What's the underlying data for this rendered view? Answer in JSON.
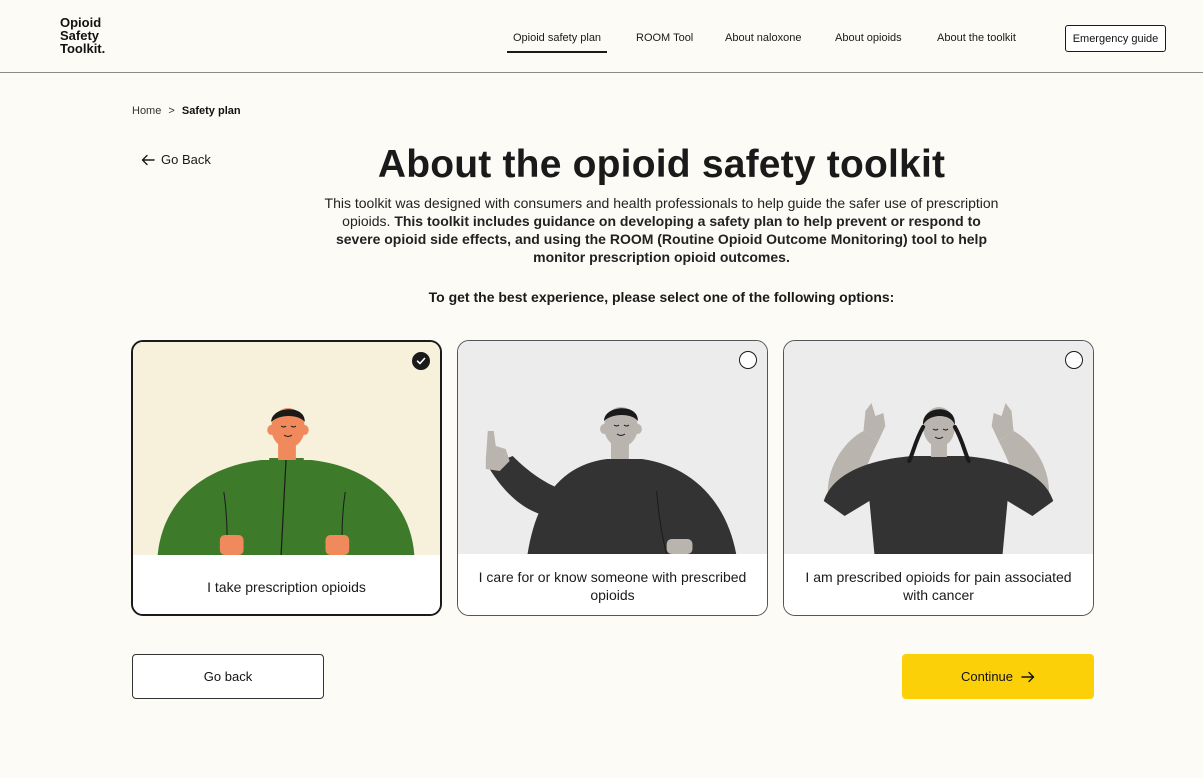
{
  "header": {
    "logo_lines": [
      "Opioid",
      "Safety",
      "Toolkit."
    ],
    "nav": [
      {
        "label": "Opioid safety plan",
        "active": true
      },
      {
        "label": "ROOM Tool",
        "active": false
      },
      {
        "label": "About naloxone",
        "active": false
      },
      {
        "label": "About opioids",
        "active": false
      },
      {
        "label": "About the toolkit",
        "active": false
      }
    ],
    "emergency_label": "Emergency guide"
  },
  "breadcrumb": {
    "home": "Home",
    "separator": ">",
    "current": "Safety plan"
  },
  "go_back_link": "Go Back",
  "title": "About the opioid safety toolkit",
  "intro": {
    "plain": "This toolkit was designed with consumers and health professionals to help guide the safer use of prescription opioids. ",
    "bold": "This toolkit includes guidance on developing a safety plan to help prevent or respond to severe opioid side effects, and using the ROOM (Routine Opioid Outcome Monitoring) tool to help monitor prescription opioid outcomes."
  },
  "prompt": "To get the best experience, please select one of the following options:",
  "options": [
    {
      "label": "I take prescription opioids",
      "selected": true
    },
    {
      "label": "I care for or know someone with prescribed opioids",
      "selected": false
    },
    {
      "label": "I am prescribed opioids for pain associated with cancer",
      "selected": false
    }
  ],
  "buttons": {
    "back": "Go back",
    "continue": "Continue"
  },
  "colors": {
    "background": "#fcfbf6",
    "accent_yellow": "#fcd008",
    "selected_card_bg": "#f7f1dc",
    "card_bg": "#ececec",
    "green_shirt": "#3d7a2a",
    "dark_shirt": "#333333",
    "skin": "#f08a5d",
    "grey_skin": "#b9b4ae"
  }
}
